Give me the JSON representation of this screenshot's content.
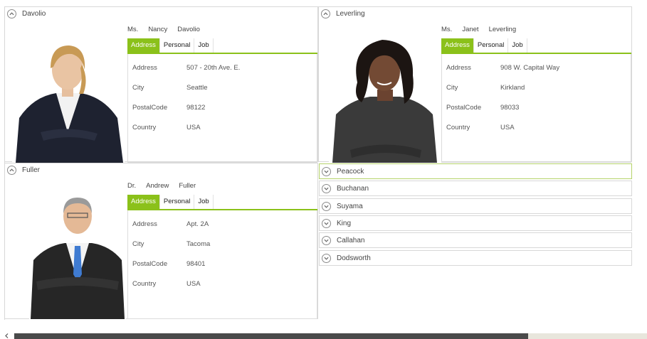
{
  "tab_labels": [
    "Address",
    "Personal",
    "Job"
  ],
  "field_labels": [
    "Address",
    "City",
    "PostalCode",
    "Country"
  ],
  "expanded_cards": [
    {
      "header": "Davolio",
      "title": "Ms.",
      "first_name": "Nancy",
      "last_name": "Davolio",
      "values": [
        "507 - 20th Ave. E.",
        "Seattle",
        "98122",
        "USA"
      ]
    },
    {
      "header": "Leverling",
      "title": "Ms.",
      "first_name": "Janet",
      "last_name": "Leverling",
      "values": [
        "908 W. Capital Way",
        "Kirkland",
        "98033",
        "USA"
      ]
    },
    {
      "header": "Fuller",
      "title": "Dr.",
      "first_name": "Andrew",
      "last_name": "Fuller",
      "values": [
        "Apt. 2A",
        "Tacoma",
        "98401",
        "USA"
      ]
    }
  ],
  "collapsed_cards": [
    "Peacock",
    "Buchanan",
    "Suyama",
    "King",
    "Callahan",
    "Dodsworth"
  ],
  "colors": {
    "accent": "#8bc11a",
    "border": "#d8d8d8",
    "scroll_thumb": "#4a4a4a"
  },
  "icons": {
    "expanded": "chevron-up-icon",
    "collapsed": "chevron-down-icon"
  }
}
